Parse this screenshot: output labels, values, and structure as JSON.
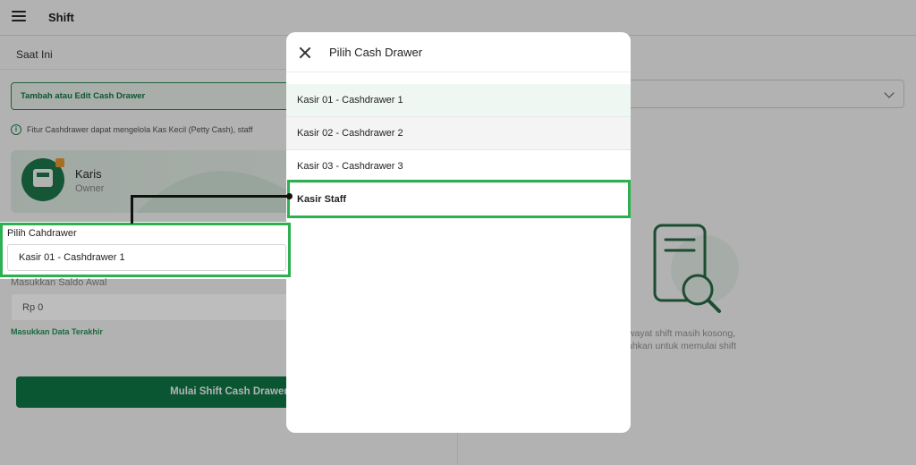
{
  "app": {
    "title": "Shift"
  },
  "left": {
    "section_title": "Saat Ini",
    "edit_drawer_label": "Tambah atau Edit Cash Drawer",
    "info_text": "Fitur Cashdrawer dapat mengelola Kas Kecil (Petty Cash), staff",
    "user": {
      "name": "Karis",
      "role": "Owner"
    },
    "pilih_label": "Pilih Cahdrawer",
    "pilih_value": "Kasir 01 - Cashdrawer 1",
    "saldo_label": "Masukkan Saldo Awal",
    "saldo_value": "Rp 0",
    "last_data_link": "Masukkan Data Terakhir",
    "start_button": "Mulai Shift Cash Drawer"
  },
  "right": {
    "empty_line1": "wayat shift masih kosong,",
    "empty_line2": "ahkan untuk memulai shift"
  },
  "modal": {
    "title": "Pilih Cash Drawer",
    "items": [
      {
        "label": "Kasir 01 - Cashdrawer 1"
      },
      {
        "label": "Kasir 02 - Cashdrawer 2"
      },
      {
        "label": "Kasir 03 - Cashdrawer 3"
      },
      {
        "label": "Kasir Staff"
      }
    ]
  },
  "colors": {
    "brand_green": "#0f7b4a",
    "highlight_green": "#2db04f"
  },
  "icons": {
    "menu": "hamburger-icon",
    "close": "close-icon",
    "info": "info-icon",
    "chevron": "chevron-down-icon",
    "empty": "document-search-icon"
  }
}
